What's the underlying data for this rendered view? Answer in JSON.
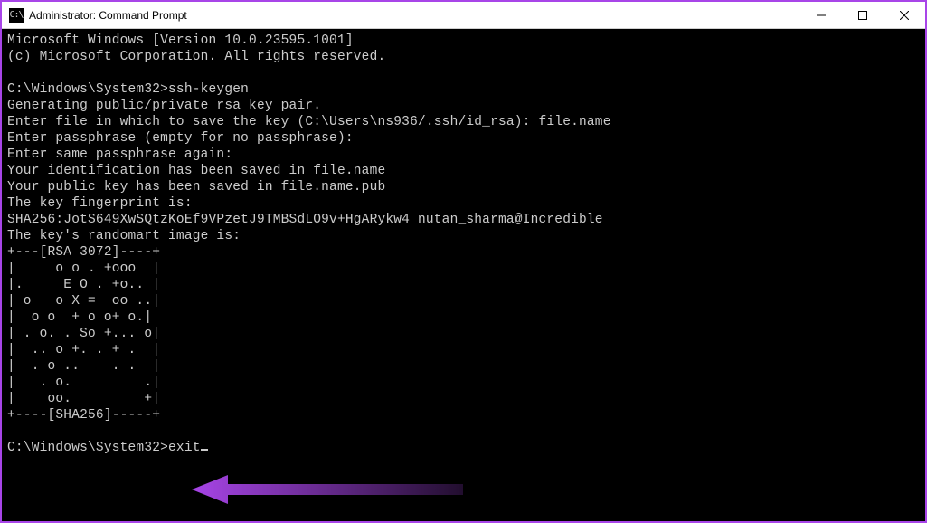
{
  "window": {
    "icon_label": "C:\\",
    "title": "Administrator: Command Prompt"
  },
  "terminal": {
    "lines": [
      "Microsoft Windows [Version 10.0.23595.1001]",
      "(c) Microsoft Corporation. All rights reserved.",
      "",
      "C:\\Windows\\System32>ssh-keygen",
      "Generating public/private rsa key pair.",
      "Enter file in which to save the key (C:\\Users\\ns936/.ssh/id_rsa): file.name",
      "Enter passphrase (empty for no passphrase):",
      "Enter same passphrase again:",
      "Your identification has been saved in file.name",
      "Your public key has been saved in file.name.pub",
      "The key fingerprint is:",
      "SHA256:JotS649XwSQtzKoEf9VPzetJ9TMBSdLO9v+HgARykw4 nutan_sharma@Incredible",
      "The key's randomart image is:",
      "+---[RSA 3072]----+",
      "|     o o . +ooo  |",
      "|.     E O . +o.. |",
      "| o   o X =  oo ..|",
      "|  o o  + o o+ o.|",
      "| . o. . So +... o|",
      "|  .. o +. . + .  |",
      "|  . o ..    . .  |",
      "|   . o.         .|",
      "|    oo.         +|",
      "+----[SHA256]-----+",
      ""
    ],
    "prompt": "C:\\Windows\\System32>",
    "current_input": "exit"
  },
  "annotation": {
    "arrow_color": "#a845e8"
  }
}
